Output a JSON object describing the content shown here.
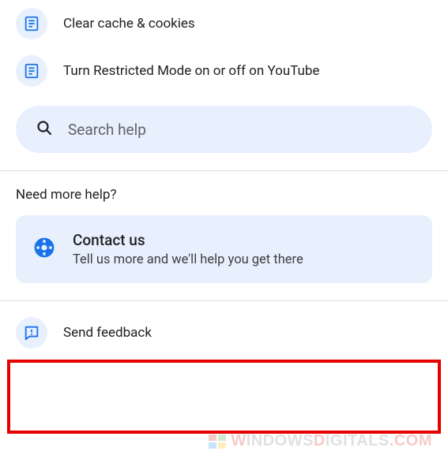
{
  "helpItems": [
    {
      "label": "Clear cache & cookies"
    },
    {
      "label": "Turn Restricted Mode on or off on YouTube"
    }
  ],
  "search": {
    "placeholder": "Search help"
  },
  "moreHelp": {
    "header": "Need more help?",
    "contact": {
      "title": "Contact us",
      "subtitle": "Tell us more and we'll help you get there"
    }
  },
  "feedback": {
    "label": "Send feedback"
  },
  "watermark": {
    "part1": "W",
    "part2": "INDOWS",
    "part3": "D",
    "part4": "IGITALS",
    "part5": ".COM"
  }
}
